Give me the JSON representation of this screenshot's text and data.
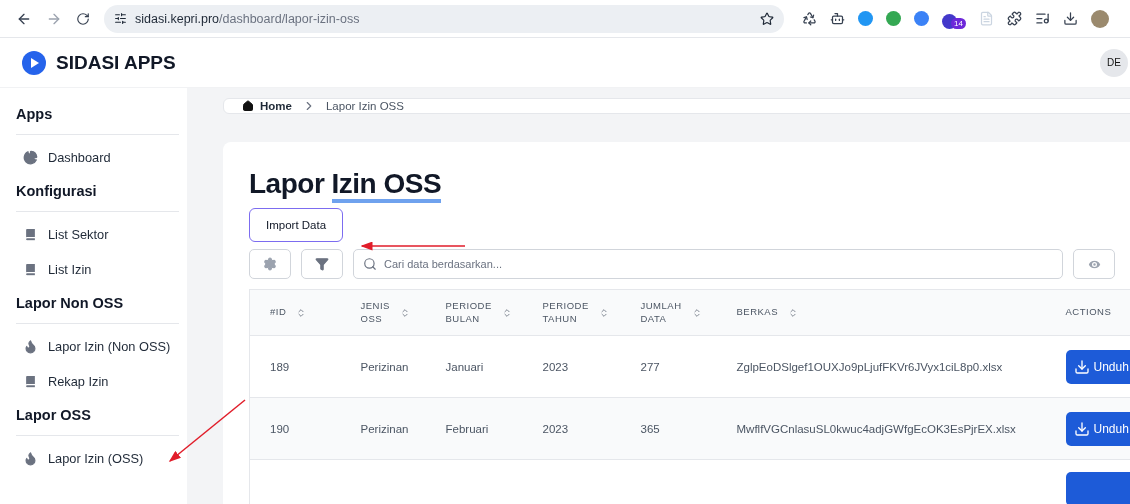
{
  "browser": {
    "url_host": "sidasi.kepri.pro",
    "url_path": "/dashboard/lapor-izin-oss",
    "extension_badge": "14"
  },
  "header": {
    "brand": "SIDASI APPS",
    "avatar": "DE"
  },
  "sidebar": {
    "sections": [
      {
        "title": "Apps",
        "items": [
          {
            "label": "Dashboard",
            "kind": "dashboard"
          }
        ]
      },
      {
        "title": "Konfigurasi",
        "items": [
          {
            "label": "List Sektor",
            "kind": "list"
          },
          {
            "label": "List Izin",
            "kind": "list"
          }
        ]
      },
      {
        "title": "Lapor Non OSS",
        "items": [
          {
            "label": "Lapor Izin (Non OSS)",
            "kind": "report"
          },
          {
            "label": "Rekap Izin",
            "kind": "list"
          }
        ]
      },
      {
        "title": "Lapor OSS",
        "items": [
          {
            "label": "Lapor Izin (OSS)",
            "kind": "report"
          }
        ]
      }
    ]
  },
  "breadcrumb": [
    {
      "label": "Home",
      "kind": "home"
    },
    {
      "label": "Lapor Izin OSS",
      "kind": "current"
    }
  ],
  "page": {
    "title": "Lapor",
    "title_highlight": "Izin OSS",
    "import_button": "Import Data",
    "search": {
      "placeholder": "Cari data berdasarkan..."
    }
  },
  "table": {
    "columns": [
      {
        "label": "#ID",
        "sortable": true
      },
      {
        "label": "JENIS OSS",
        "sortable": true
      },
      {
        "label": "PERIODE BULAN",
        "sortable": true
      },
      {
        "label": "PERIODE TAHUN",
        "sortable": true
      },
      {
        "label": "JUMLAH DATA",
        "sortable": true
      },
      {
        "label": "BERKAS",
        "sortable": true
      },
      {
        "label": "ACTIONS",
        "sortable": false
      }
    ],
    "rows": [
      {
        "cells": [
          "189",
          "Perizinan",
          "Januari",
          "2023",
          "277",
          "ZglpEoDSlgef1OUXJo9pLjufFKVr6JVyx1ciL8p0.xlsx"
        ],
        "action": "Unduh"
      },
      {
        "cells": [
          "190",
          "Perizinan",
          "Februari",
          "2023",
          "365",
          "MwflfVGCnlasuSL0kwuc4adjGWfgEcOK3EsPjrEX.xlsx"
        ],
        "action": "Unduh"
      }
    ]
  }
}
